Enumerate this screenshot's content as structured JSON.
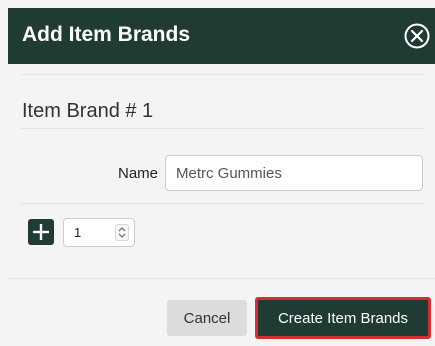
{
  "modal": {
    "title": "Add Item Brands",
    "close_icon": "circle-x-icon"
  },
  "item": {
    "heading": "Item Brand # 1",
    "name_label": "Name",
    "name_value": "Metrc Gummies"
  },
  "quantity": {
    "add_icon": "plus-icon",
    "value": "1",
    "stepper_icon": "up-down-arrows-icon"
  },
  "footer": {
    "cancel_label": "Cancel",
    "create_label": "Create Item Brands"
  },
  "colors": {
    "header_bg": "#1f3b33",
    "primary": "#1f3b33",
    "highlight_border": "#d32f2f",
    "page_bg": "#f4f4f4"
  }
}
